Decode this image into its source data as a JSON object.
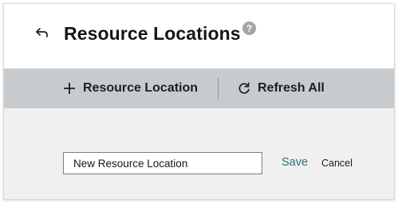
{
  "header": {
    "title": "Resource Locations",
    "back_icon": "back-arrow-icon",
    "help_icon": "question-circle-icon",
    "help_glyph": "?"
  },
  "toolbar": {
    "add_label": "Resource Location",
    "add_icon": "plus-icon",
    "refresh_label": "Refresh All",
    "refresh_icon": "refresh-icon"
  },
  "form": {
    "name_value": "New Resource Location",
    "save_label": "Save",
    "cancel_label": "Cancel"
  },
  "colors": {
    "toolbar_bg": "#c7cbce",
    "body_bg": "#f0f0f0",
    "save_link": "#2b6f86"
  }
}
